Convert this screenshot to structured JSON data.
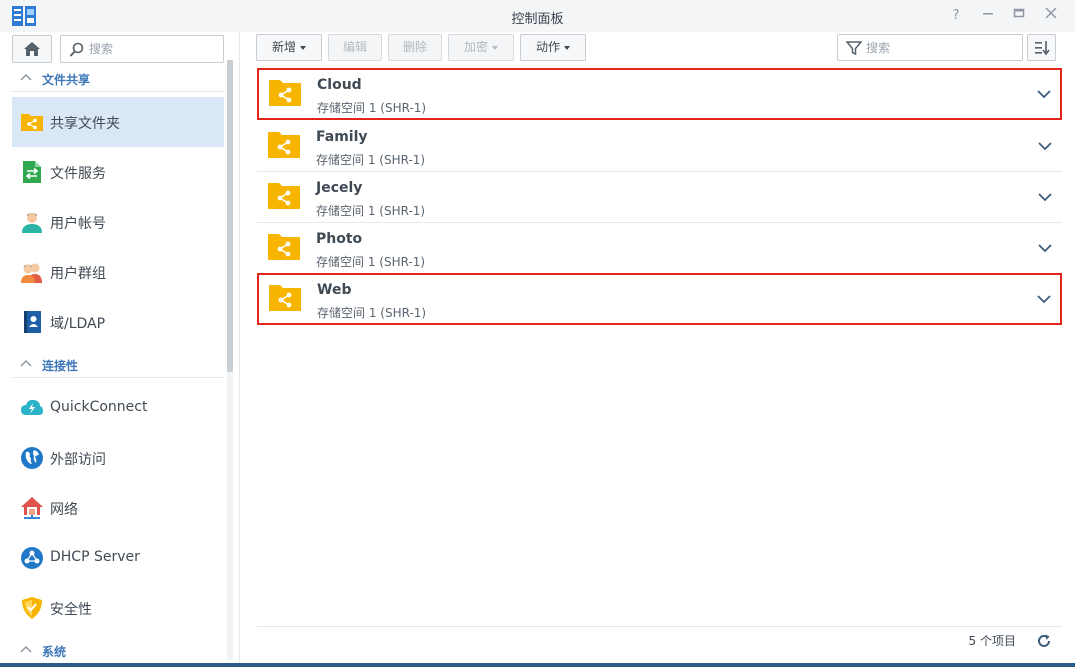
{
  "window": {
    "title": "控制面板",
    "app_icon": "control-panel-icon",
    "controls": [
      "help-icon",
      "minimize-icon",
      "maximize-icon",
      "close-icon"
    ]
  },
  "sidebar": {
    "search_placeholder": "搜索",
    "sections": [
      {
        "label": "文件共享",
        "items": [
          {
            "label": "共享文件夹",
            "icon": "shared-folder-icon",
            "active": true
          },
          {
            "label": "文件服务",
            "icon": "file-services-icon"
          },
          {
            "label": "用户帐号",
            "icon": "user-icon"
          },
          {
            "label": "用户群组",
            "icon": "group-icon"
          },
          {
            "label": "域/LDAP",
            "icon": "domain-ldap-icon"
          }
        ]
      },
      {
        "label": "连接性",
        "items": [
          {
            "label": "QuickConnect",
            "icon": "quickconnect-icon"
          },
          {
            "label": "外部访问",
            "icon": "external-access-icon"
          },
          {
            "label": "网络",
            "icon": "network-icon"
          },
          {
            "label": "DHCP Server",
            "icon": "dhcp-server-icon"
          },
          {
            "label": "安全性",
            "icon": "security-icon"
          }
        ]
      },
      {
        "label": "系统",
        "items": []
      }
    ]
  },
  "toolbar": {
    "create": "新增",
    "edit": "编辑",
    "delete": "删除",
    "encrypt": "加密",
    "action": "动作",
    "filter_placeholder": "搜索"
  },
  "folders": [
    {
      "name": "Cloud",
      "location": "存储空间 1 (SHR-1)",
      "highlighted": true
    },
    {
      "name": "Family",
      "location": "存储空间 1 (SHR-1)",
      "highlighted": false
    },
    {
      "name": "Jecely",
      "location": "存储空间 1 (SHR-1)",
      "highlighted": false
    },
    {
      "name": "Photo",
      "location": "存储空间 1 (SHR-1)",
      "highlighted": false
    },
    {
      "name": "Web",
      "location": "存储空间 1 (SHR-1)",
      "highlighted": true
    }
  ],
  "footer": {
    "count": "5 个项目"
  },
  "colors": {
    "accent": "#3e78b8",
    "folder": "#f7b500",
    "highlight": "#e1251b",
    "active_item": "#d9e7f6"
  }
}
